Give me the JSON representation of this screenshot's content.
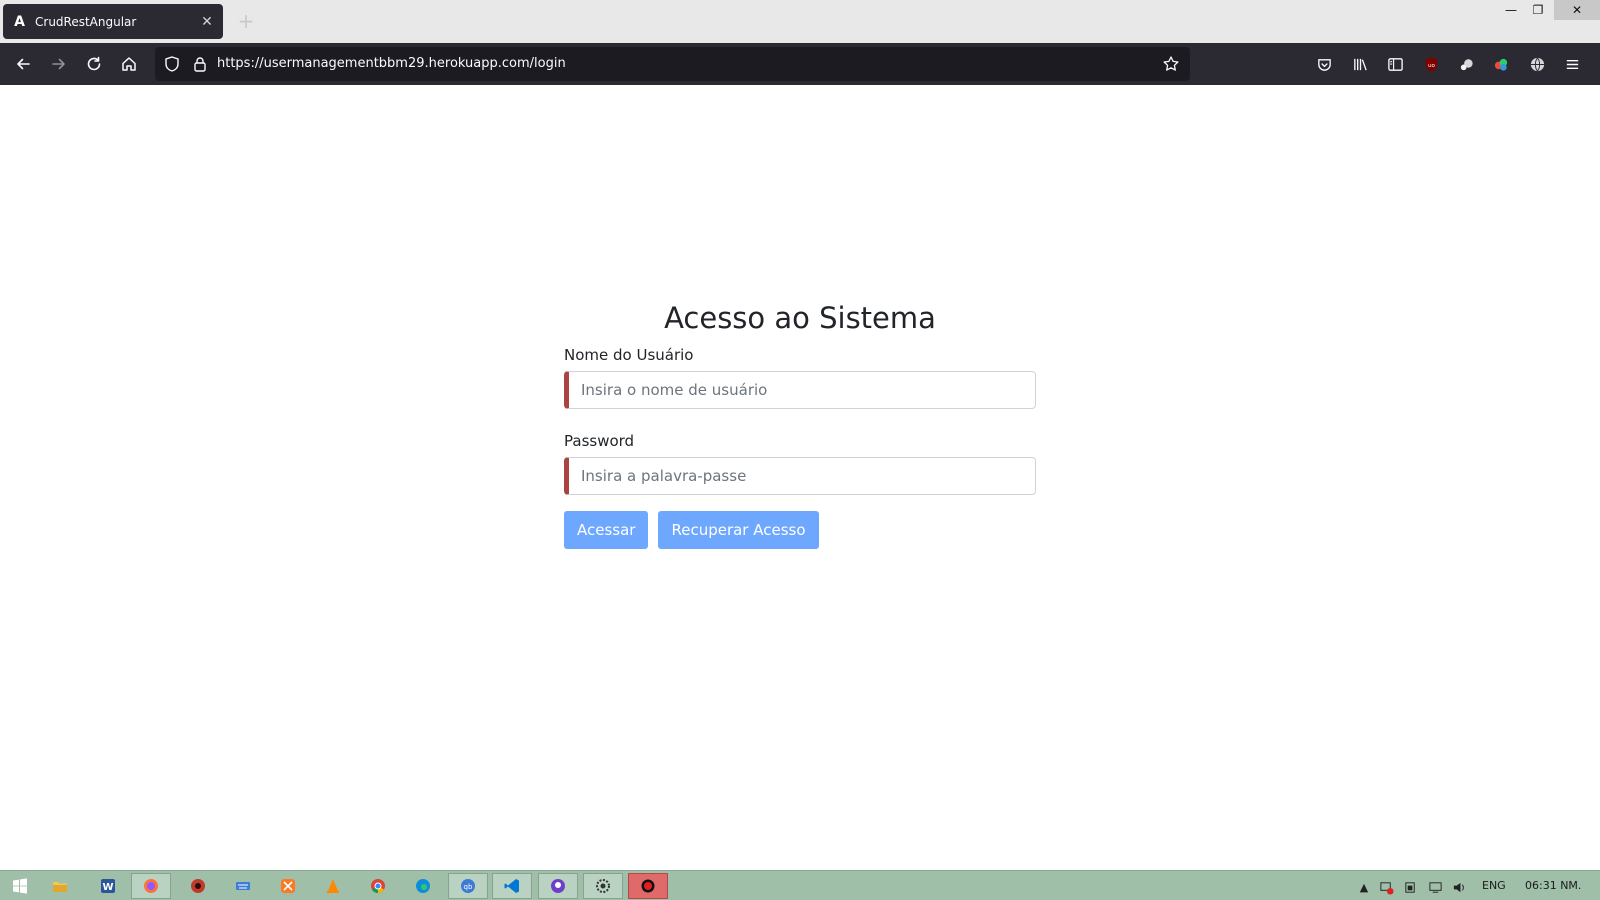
{
  "browser": {
    "tab_title": "CrudRestAngular",
    "tab_favicon": "A",
    "url": "https://usermanagementbbm29.herokuapp.com/login"
  },
  "page": {
    "title": "Acesso ao Sistema",
    "username_label": "Nome do Usuário",
    "username_placeholder": "Insira o nome de usuário",
    "username_value": "",
    "password_label": "Password",
    "password_placeholder": "Insira a palavra-passe",
    "password_value": "",
    "login_button": "Acessar",
    "recover_button": "Recuperar Acesso"
  },
  "colors": {
    "button_bg": "#6ea8fe",
    "invalid_border": "#a94442",
    "browser_chrome": "#2b2a33",
    "taskbar": "#9fbfa9"
  },
  "taskbar": {
    "apps": [
      "start-icon",
      "file-explorer-icon",
      "word-icon",
      "firefox-icon",
      "app-red-icon",
      "keyboard-icon",
      "xampp-icon",
      "vlc-icon",
      "chrome-icon",
      "edge-icon",
      "qbittorrent-icon",
      "vscode-icon",
      "github-icon",
      "settings-icon",
      "record-icon"
    ],
    "language": "ENG",
    "clock": "06:31 NM."
  }
}
